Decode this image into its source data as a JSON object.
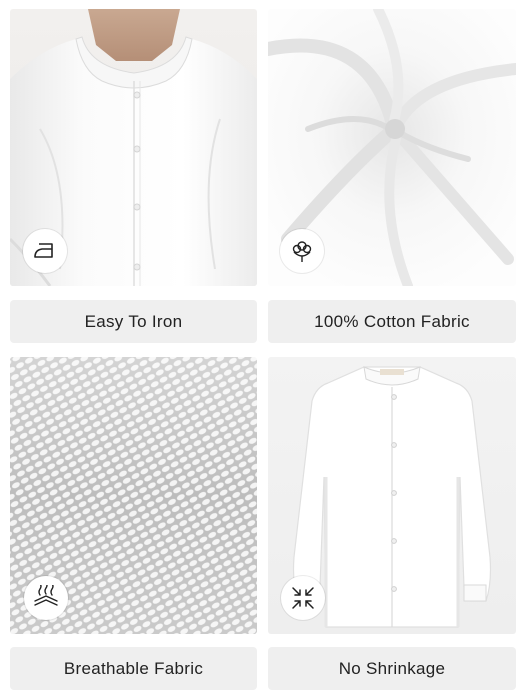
{
  "features": [
    {
      "label": "Easy To Iron",
      "icon": "iron-icon"
    },
    {
      "label": "100% Cotton Fabric",
      "icon": "cotton-flower-icon"
    },
    {
      "label": "Breathable Fabric",
      "icon": "breathable-fabric-icon"
    },
    {
      "label": "No Shrinkage",
      "icon": "no-shrinkage-icon"
    }
  ]
}
